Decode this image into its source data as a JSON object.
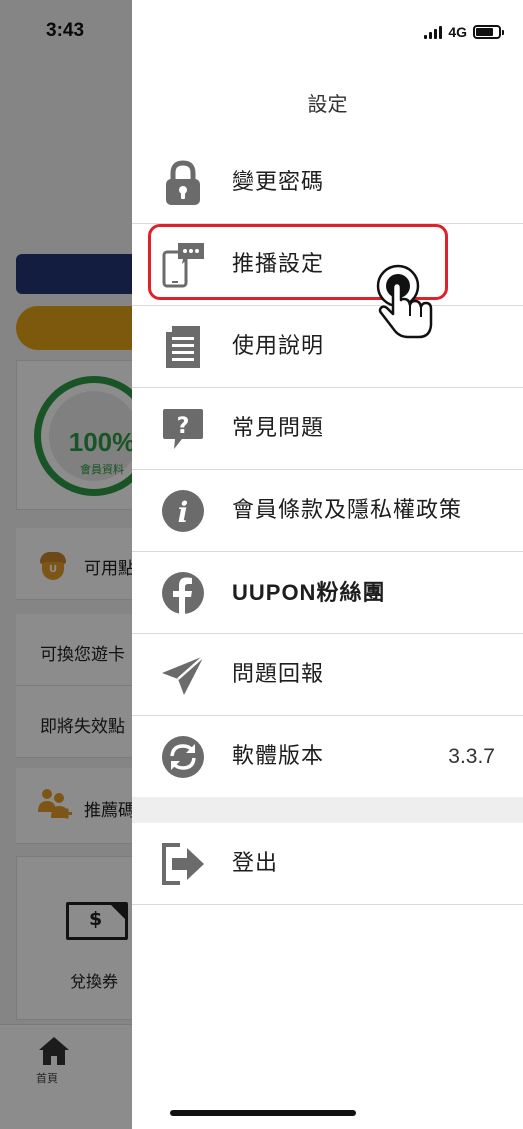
{
  "status_bar": {
    "time": "3:43",
    "network": "4G"
  },
  "background_app": {
    "progress_percent": "100%",
    "progress_label": "會員資料",
    "points_label": "可用點",
    "exchange_label": "可換您遊卡",
    "expiring_label": "即將失效點",
    "referral_label": "推薦碼",
    "voucher_icon_text": "$",
    "voucher_label": "兌換券",
    "tab_home_label": "首頁"
  },
  "drawer": {
    "title": "設定",
    "items": [
      {
        "label": "變更密碼",
        "icon": "lock-icon"
      },
      {
        "label": "推播設定",
        "icon": "push-notification-icon"
      },
      {
        "label": "使用說明",
        "icon": "document-icon"
      },
      {
        "label": "常見問題",
        "icon": "question-bubble-icon"
      },
      {
        "label": "會員條款及隱私權政策",
        "icon": "info-icon"
      },
      {
        "label": "UUPON粉絲團",
        "icon": "facebook-icon"
      },
      {
        "label": "問題回報",
        "icon": "paper-plane-icon"
      },
      {
        "label": "軟體版本",
        "icon": "sync-icon",
        "value": "3.3.7"
      }
    ],
    "logout_label": "登出"
  },
  "colors": {
    "accent_highlight": "#e0202a",
    "icon_gray": "#6b6b6b",
    "navy": "#243575",
    "gold": "#e3a21a",
    "ring_green": "#2f9a45"
  }
}
